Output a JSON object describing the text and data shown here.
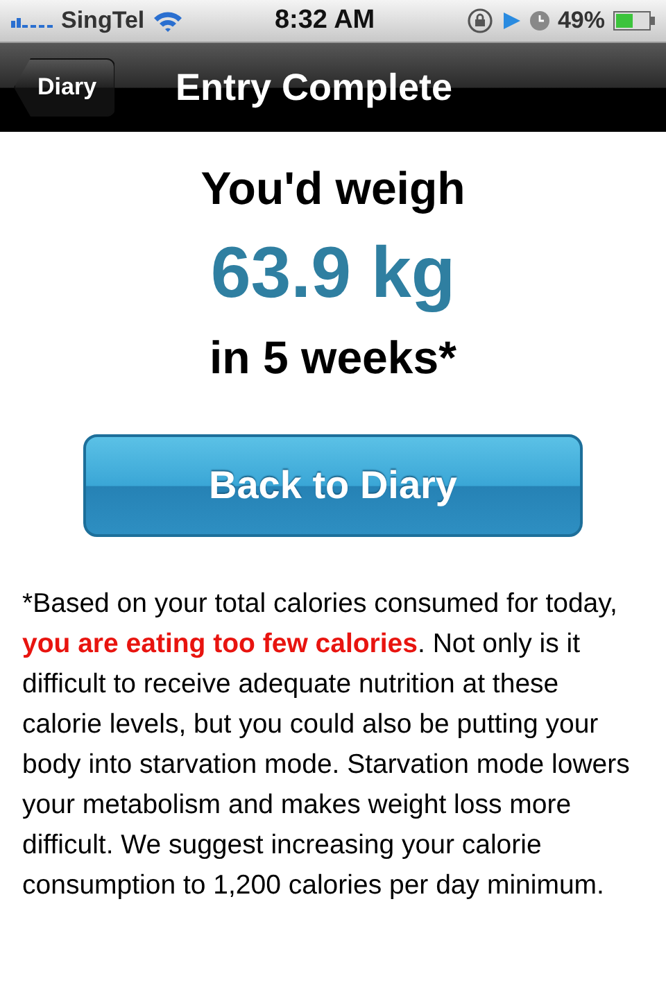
{
  "status_bar": {
    "carrier": "SingTel",
    "time": "8:32 AM",
    "battery": "49%"
  },
  "nav_bar": {
    "back": "Diary",
    "title": "Entry Complete"
  },
  "result": {
    "lead": "You'd weigh",
    "weight": "63.9 kg",
    "period": "in 5 weeks*"
  },
  "button": "Back to Diary",
  "note": "*Based on your total calories consumed for today, **you are eating too few calories**. Not only is it difficult to receive adequate nutrition at these calorie levels, but you could also be putting your body into starvation mode. Starvation mode lowers your metabolism and makes weight loss more difficult. We suggest increasing your calorie consumption to 1,200 calories per day minimum."
}
